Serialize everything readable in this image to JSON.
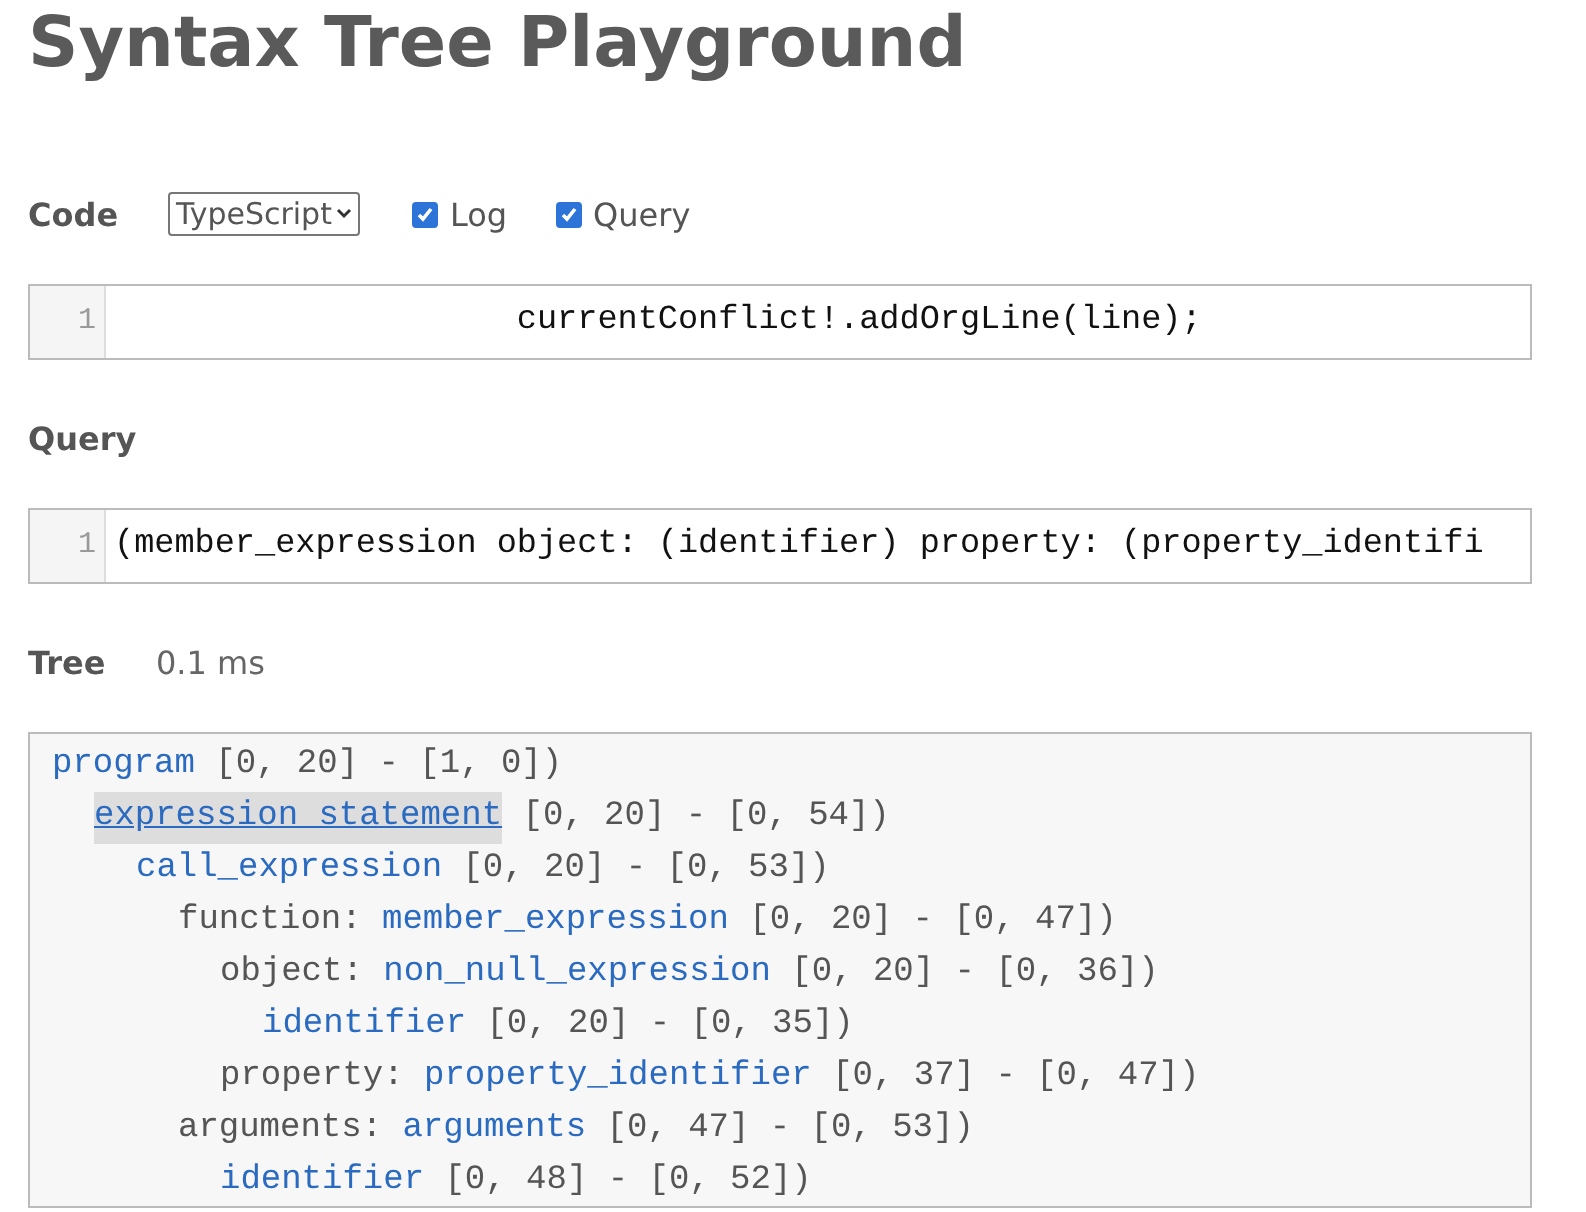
{
  "title": "Syntax Tree Playground",
  "code": {
    "label": "Code",
    "language": "TypeScript",
    "options": [
      {
        "label": "Log",
        "checked": true
      },
      {
        "label": "Query",
        "checked": true
      }
    ],
    "editor": {
      "line_number": "1",
      "text": "                    currentConflict!.addOrgLine(line);"
    }
  },
  "query": {
    "label": "Query",
    "editor": {
      "line_number": "1",
      "text": "(member_expression object: (identifier) property: (property_identifi"
    }
  },
  "tree": {
    "label": "Tree",
    "timing": "0.1 ms",
    "nodes": [
      {
        "type": "program",
        "range": "[0, 20] - [1, 0])",
        "selected": false,
        "children": [
          {
            "type": "expression_statement",
            "range": "[0, 20] - [0, 54])",
            "selected": true,
            "children": [
              {
                "type": "call_expression",
                "range": "[0, 20] - [0, 53])",
                "selected": false,
                "children": [
                  {
                    "field": "function:",
                    "type": "member_expression",
                    "range": "[0, 20] - [0, 47])",
                    "selected": false,
                    "children": [
                      {
                        "field": "object:",
                        "type": "non_null_expression",
                        "range": "[0, 20] - [0, 36])",
                        "selected": false,
                        "children": [
                          {
                            "type": "identifier",
                            "range": "[0, 20] - [0, 35])",
                            "selected": false
                          }
                        ]
                      },
                      {
                        "field": "property:",
                        "type": "property_identifier",
                        "range": "[0, 37] - [0, 47])",
                        "selected": false
                      }
                    ]
                  },
                  {
                    "field": "arguments:",
                    "type": "arguments",
                    "range": "[0, 47] - [0, 53])",
                    "selected": false,
                    "children": [
                      {
                        "type": "identifier",
                        "range": "[0, 48] - [0, 52])",
                        "selected": false
                      }
                    ]
                  }
                ]
              }
            ]
          }
        ]
      }
    ]
  }
}
